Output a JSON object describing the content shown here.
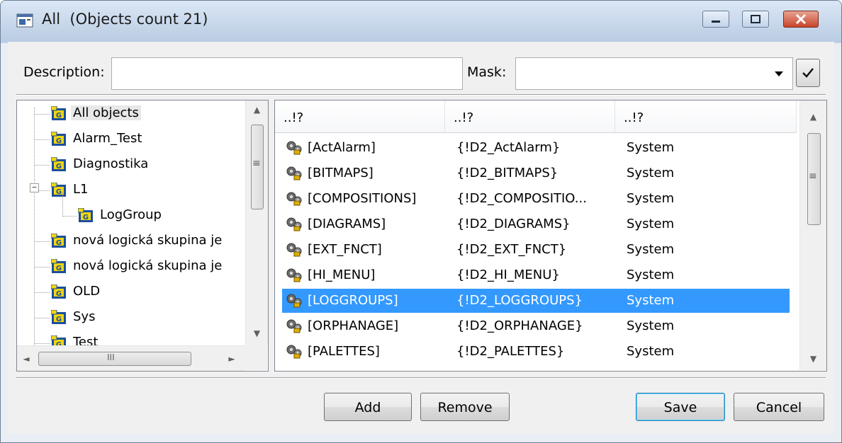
{
  "window": {
    "title": "All  (Objects count 21)",
    "icon": "object-list-icon"
  },
  "filter": {
    "description_label": "Description:",
    "description_value": "",
    "mask_label": "Mask:",
    "mask_value": "",
    "mask_dropdown_icon": "chevron-down-icon",
    "apply_icon": "checkmark-icon"
  },
  "tree": {
    "items": [
      {
        "label": "All objects",
        "selected": true
      },
      {
        "label": "Alarm_Test"
      },
      {
        "label": "Diagnostika"
      },
      {
        "label": "L1",
        "expanded": true
      },
      {
        "label": "LogGroup"
      },
      {
        "label": "nová logická skupina je"
      },
      {
        "label": "nová logická skupina je"
      },
      {
        "label": "OLD"
      },
      {
        "label": "Sys"
      },
      {
        "label": "Test"
      }
    ],
    "expander_glyph": "−",
    "hscroll_grip": "III"
  },
  "list": {
    "columns": [
      "..!?",
      "..!?",
      "..!?"
    ],
    "rows": [
      {
        "name": "[ActAlarm]",
        "id": "{!D2_ActAlarm}",
        "type": "System"
      },
      {
        "name": "[BITMAPS]",
        "id": "{!D2_BITMAPS}",
        "type": "System"
      },
      {
        "name": "[COMPOSITIONS]",
        "id": "{!D2_COMPOSITIO...",
        "type": "System"
      },
      {
        "name": "[DIAGRAMS]",
        "id": "{!D2_DIAGRAMS}",
        "type": "System"
      },
      {
        "name": "[EXT_FNCT]",
        "id": "{!D2_EXT_FNCT}",
        "type": "System"
      },
      {
        "name": "[HI_MENU]",
        "id": "{!D2_HI_MENU}",
        "type": "System"
      },
      {
        "name": "[LOGGROUPS]",
        "id": "{!D2_LOGGROUPS}",
        "type": "System",
        "selected": true
      },
      {
        "name": "[ORPHANAGE]",
        "id": "{!D2_ORPHANAGE}",
        "type": "System"
      },
      {
        "name": "[PALETTES]",
        "id": "{!D2_PALETTES}",
        "type": "System"
      }
    ]
  },
  "buttons": {
    "add": "Add",
    "remove": "Remove",
    "save": "Save",
    "cancel": "Cancel"
  },
  "scroll_glyphs": {
    "up": "▲",
    "down": "▼",
    "left": "◄",
    "right": "►",
    "grip": "≡"
  },
  "colors": {
    "selection": "#3399ff",
    "close_button": "#c7452a"
  }
}
